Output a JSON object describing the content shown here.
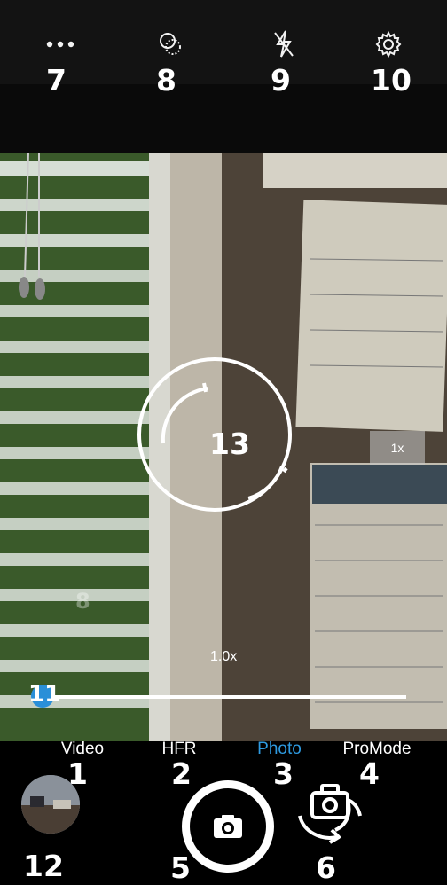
{
  "top_icons": {
    "more": {
      "icon": "more-dots-icon",
      "badge": "7"
    },
    "filter": {
      "icon": "filter-circles-icon",
      "badge": "8"
    },
    "flash": {
      "icon": "flash-off-icon",
      "badge": "9"
    },
    "settings": {
      "icon": "gear-icon",
      "badge": "10"
    }
  },
  "viewfinder": {
    "focus_badge": "13",
    "zoom_button": "1x",
    "faint_badge": "8",
    "zoom_level": "1.0x",
    "zoom_slider_badge": "11"
  },
  "modes": [
    {
      "label": "Video",
      "badge": "1"
    },
    {
      "label": "HFR",
      "badge": "2"
    },
    {
      "label": "Photo",
      "badge": "3",
      "active": true
    },
    {
      "label": "ProMode",
      "badge": "4"
    }
  ],
  "controls": {
    "shutter_badge": "5",
    "switch_camera_badge": "6",
    "gallery_badge": "12"
  },
  "colors": {
    "accent": "#2e9ae0"
  }
}
